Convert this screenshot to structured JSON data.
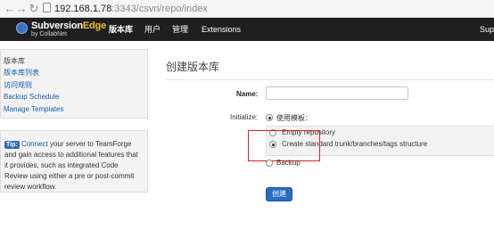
{
  "browser": {
    "url_host": "192.168.1.78",
    "url_path": ":3343/csvn/repo/index"
  },
  "brand": {
    "name_part1": "Subversion",
    "name_part2": "Edge",
    "byline": "by CollabNet"
  },
  "topnav": {
    "items": [
      "版本库",
      "用户",
      "管理",
      "Extensions",
      "Sup"
    ]
  },
  "sidebar": {
    "heading": "版本库",
    "links": [
      "版本库列表",
      "访问规则",
      "Backup Schedule",
      "Manage Templates"
    ]
  },
  "tip": {
    "badge": "Tip:",
    "link": "Connect",
    "text": " your server to TeamForge and gain access to additional features that it provides, such as integrated Code Review using either a pre or post-commit review workflow."
  },
  "form": {
    "title": "创建版本库",
    "name_label": "Name:",
    "name_value": "",
    "initialize_label": "Initialize:",
    "use_template_label": "使用模板：",
    "template_options": [
      "Empty repository",
      "Create standard trunk/branches/tags structure"
    ],
    "selected_template": "Create standard trunk/branches/tags structure",
    "backup_label": "Backup",
    "submit_label": "创建"
  },
  "colors": {
    "header_bg": "#1f1f1f",
    "brand_accent": "#f0c21e",
    "link": "#1a5aa6",
    "button": "#2b6cc4",
    "highlight_box": "#e02020"
  }
}
